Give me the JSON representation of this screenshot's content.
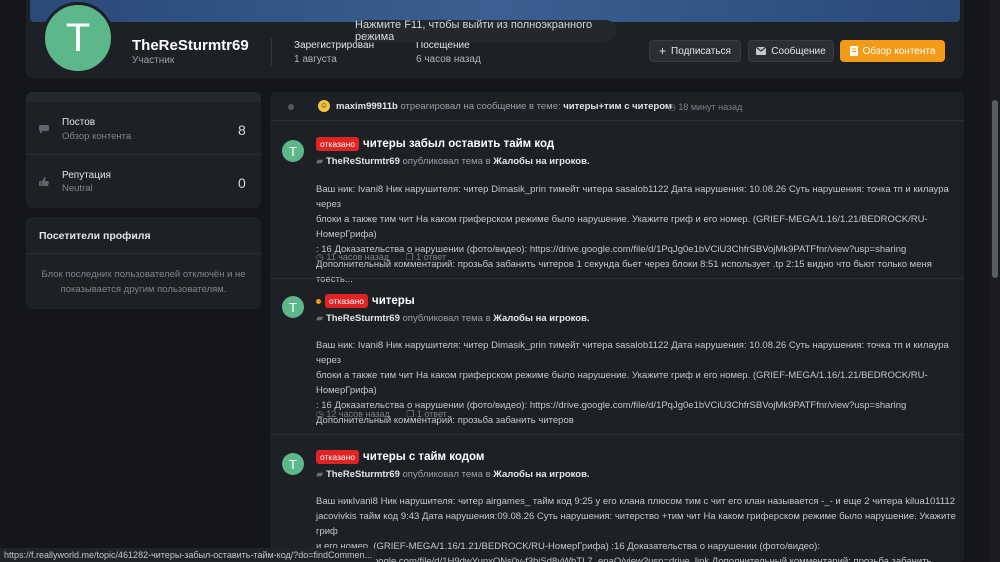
{
  "tooltip": "Нажмите F11, чтобы выйти из полноэкранного режима",
  "profile": {
    "avatar_letter": "T",
    "username": "TheReSturmtr69",
    "role": "Участник",
    "registered_label": "Зарегистрирован",
    "registered_value": "1 августа",
    "visit_label": "Посещение",
    "visit_value": "6 часов назад",
    "subscribe_label": "Подписаться",
    "message_label": "Сообщение",
    "content_label": "Обзор контента",
    "accent": "#f39a16"
  },
  "sidebar": {
    "posts_label": "Постов",
    "posts_sub": "Обзор контента",
    "posts_count": "8",
    "rep_label": "Репутация",
    "rep_sub": "Neutral",
    "rep_count": "0",
    "visitors_title": "Посетители профиля",
    "visitors_text": "Блок последних пользователей отключён и не показывается другим пользователям."
  },
  "activity": {
    "user": "maxim99911b",
    "text": "отреагировал на сообщение в теме:",
    "topic": "читеры+тим с читером",
    "time": "18 минут назад"
  },
  "posts": [
    {
      "badge": "отказано",
      "title": "читеры забыл оставить тайм код",
      "author": "TheReSturmtr69",
      "action": "опубликовал тема в",
      "forum": "Жалобы на игроков.",
      "body": [
        "Ваш ник: Ivani8 Ник нарушителя: читер Dimasik_prin тимейт читера sasalob1122 Дата нарушения: 10.08.26 Суть нарушения: точка тп и килаура через",
        "блоки а также тим чит На каком гриферском режиме было нарушение. Укажите гриф и его номер. (GRIEF-MEGA/1.16/1.21/BEDROCK/RU-НомерГрифа)",
        ": 16 Доказательства о нарушении (фото/видео): https://drive.google.com/file/d/1PqJg0e1bVCiU3ChfrSBVojMk9PATFfnr/view?usp=sharing",
        "Дополнительный комментарий: прозьба забанить читеров 1 секунда бьет через блоки 8:51 использует .tp 2:15 видно что бьют только меня тоесть..."
      ],
      "time": "11 часов назад",
      "replies": "1 ответ"
    },
    {
      "badge": "отказано",
      "title": "читеры",
      "author": "TheReSturmtr69",
      "action": "опубликовал тема в",
      "forum": "Жалобы на игроков.",
      "body": [
        "Ваш ник: Ivani8 Ник нарушителя: читер Dimasik_prin тимейт читера sasalob1122 Дата нарушения: 10.08.26 Суть нарушения: точка тп и килаура через",
        "блоки а также тим чит На каком гриферском режиме было нарушение. Укажите гриф и его номер. (GRIEF-MEGA/1.16/1.21/BEDROCK/RU-НомерГрифа)",
        ": 16 Доказательства о нарушении (фото/видео): https://drive.google.com/file/d/1PqJg0e1bVCiU3ChfrSBVojMk9PATFfnr/view?usp=sharing",
        "Дополнительный комментарий: прозьба забанить читеров"
      ],
      "time": "12 часов назад",
      "replies": "1 ответ"
    },
    {
      "badge": "отказано",
      "title": "читеры с тайм кодом",
      "author": "TheReSturmtr69",
      "action": "опубликовал тема в",
      "forum": "Жалобы на игроков.",
      "body": [
        "Ваш никIvani8 Ник нарушителя: читер airgames_ тайм код 9:25 у его клана плюсом тим с чит его клан называется -_- и еще 2 читера kilua101112",
        "jacovivkis тайм код 9:43 Дата нарушения:09.08.26 Суть нарушения: читерство +тим чит На каком гриферском режиме было нарушение. Укажите гриф",
        "и его номер. (GRIEF-MEGA/1.16/1.21/BEDROCK/RU-НомерГрифа) :16 Доказательства о нарушении (фото/видео):",
        "https://drive.google.com/file/d/1H9dwYunxONs0v-f3biSd8yWhTL7_enaO/view?usp=drive_link Дополнительный комментарий: прозьба забанить"
      ]
    }
  ],
  "status_url": "https://f.reallyworld.me/topic/461282-читеры-забыл-оставить-тайм-код/?do=findCommen..."
}
